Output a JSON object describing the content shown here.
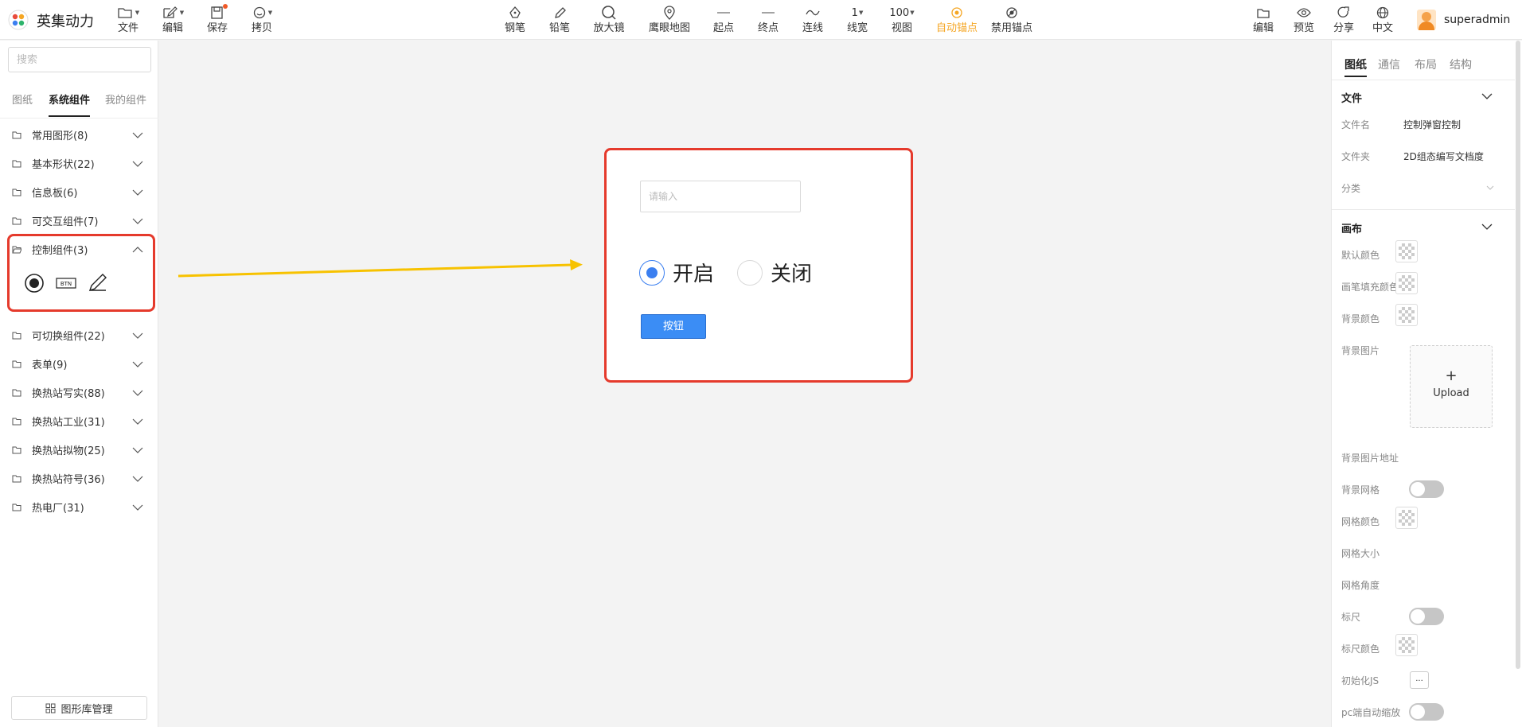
{
  "app": {
    "title": "英集动力"
  },
  "toolbar": {
    "left": [
      {
        "label": "文件"
      },
      {
        "label": "编辑"
      },
      {
        "label": "保存"
      },
      {
        "label": "拷贝"
      }
    ],
    "center": [
      {
        "label": "钢笔"
      },
      {
        "label": "铅笔"
      },
      {
        "label": "放大镜"
      },
      {
        "label": "鹰眼地图"
      },
      {
        "label": "起点"
      },
      {
        "label": "终点"
      },
      {
        "label": "连线"
      },
      {
        "label": "线宽",
        "value": "1"
      },
      {
        "label": "视图",
        "value": "100"
      },
      {
        "label": "自动锚点",
        "active": true
      },
      {
        "label": "禁用锚点"
      }
    ],
    "right": [
      {
        "label": "编辑"
      },
      {
        "label": "预览"
      },
      {
        "label": "分享"
      },
      {
        "label": "中文"
      }
    ],
    "user": "superadmin"
  },
  "sidebar": {
    "search_placeholder": "搜索",
    "tabs": [
      "图纸",
      "系统组件",
      "我的组件"
    ],
    "categories": [
      {
        "label": "常用图形(8)"
      },
      {
        "label": "基本形状(22)"
      },
      {
        "label": "信息板(6)"
      },
      {
        "label": "可交互组件(7)"
      },
      {
        "label": "控制组件(3)",
        "expanded": true
      },
      {
        "label": "可切换组件(22)"
      },
      {
        "label": "表单(9)"
      },
      {
        "label": "换热站写实(88)"
      },
      {
        "label": "换热站工业(31)"
      },
      {
        "label": "换热站拟物(25)"
      },
      {
        "label": "换热站符号(36)"
      },
      {
        "label": "热电厂(31)"
      }
    ],
    "control_components": [
      "radio-icon",
      "btn-icon",
      "pen-icon"
    ],
    "btn_icon_text": "BTN",
    "library_button": "图形库管理"
  },
  "canvas": {
    "input_placeholder": "请输入",
    "radio_on": "开启",
    "radio_off": "关闭",
    "button_label": "按钮"
  },
  "panel": {
    "tabs": [
      "图纸",
      "通信",
      "布局",
      "结构"
    ],
    "file": {
      "title": "文件",
      "name_label": "文件名",
      "name_value": "控制弹窗控制",
      "folder_label": "文件夹",
      "folder_value": "2D组态编写文档度",
      "category_label": "分类"
    },
    "canvas": {
      "title": "画布",
      "default_color": "默认颜色",
      "pen_fill_color": "画笔填充颜色",
      "bg_color": "背景颜色",
      "bg_image": "背景图片",
      "upload_plus": "+",
      "upload": "Upload",
      "bg_image_url": "背景图片地址",
      "bg_grid": "背景网格",
      "grid_color": "网格颜色",
      "grid_size": "网格大小",
      "grid_angle": "网格角度",
      "ruler": "标尺",
      "ruler_color": "标尺颜色",
      "init_js": "初始化JS",
      "init_js_button": "...",
      "pc_auto_zoom": "pc端自动缩放"
    }
  },
  "colors": {
    "accent": "#3b7ff0",
    "highlight": "#e53a2c",
    "active_tool": "#f5a623",
    "arrow": "#f7c200"
  }
}
